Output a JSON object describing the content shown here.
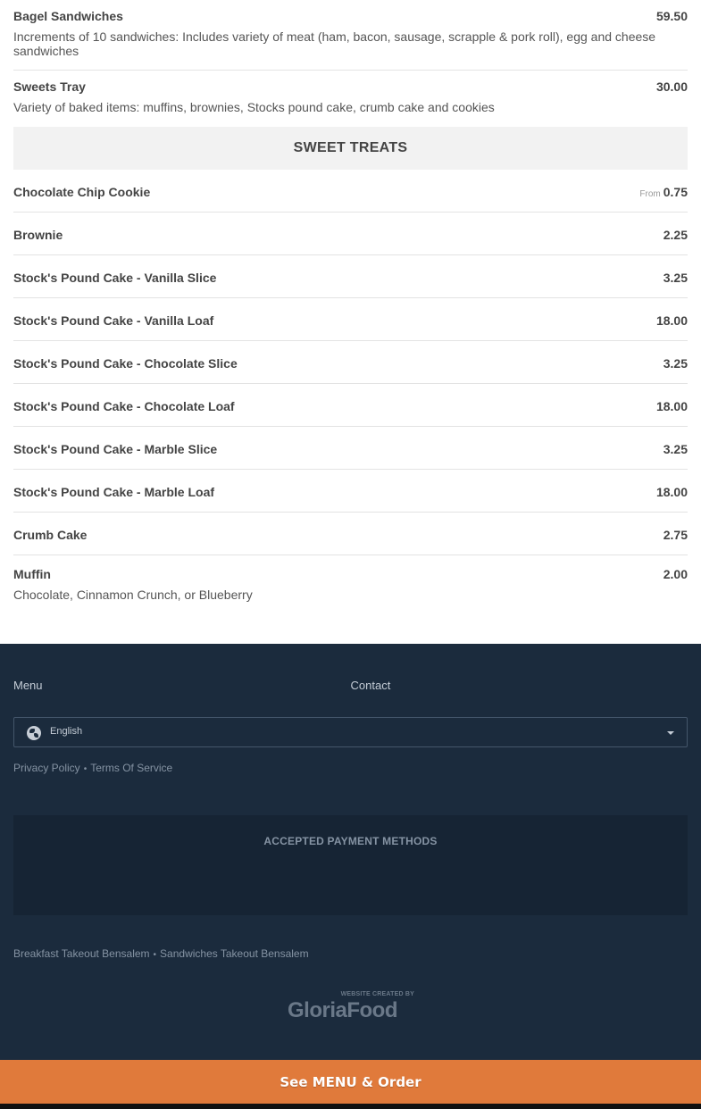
{
  "menu": {
    "items_top": [
      {
        "name": "Bagel Sandwiches",
        "price": "59.50",
        "desc": "Increments of 10 sandwiches: Includes variety of meat (ham, bacon, sausage, scrapple & pork roll), egg and cheese sandwiches"
      },
      {
        "name": "Sweets Tray",
        "price": "30.00",
        "desc": "Variety of baked items: muffins, brownies, Stocks pound cake, crumb cake and cookies"
      }
    ],
    "section_title": "SWEET TREATS",
    "sweet_items": [
      {
        "name": "Chocolate Chip Cookie",
        "price": "0.75",
        "prefix": "From"
      },
      {
        "name": "Brownie",
        "price": "2.25"
      },
      {
        "name": "Stock's Pound Cake - Vanilla Slice",
        "price": "3.25"
      },
      {
        "name": "Stock's Pound Cake - Vanilla Loaf",
        "price": "18.00"
      },
      {
        "name": "Stock's Pound Cake - Chocolate Slice",
        "price": "3.25"
      },
      {
        "name": "Stock's Pound Cake - Chocolate Loaf",
        "price": "18.00"
      },
      {
        "name": "Stock's Pound Cake - Marble Slice",
        "price": "3.25"
      },
      {
        "name": "Stock's Pound Cake - Marble Loaf",
        "price": "18.00"
      },
      {
        "name": "Crumb Cake",
        "price": "2.75"
      },
      {
        "name": "Muffin",
        "price": "2.00",
        "desc": "Chocolate, Cinnamon Crunch, or Blueberry"
      }
    ]
  },
  "footer": {
    "links": {
      "menu": "Menu",
      "contact": "Contact"
    },
    "language": {
      "selected": "English",
      "icon": "globe-icon"
    },
    "legal": {
      "privacy": "Privacy Policy",
      "terms": "Terms Of Service",
      "separator": "•"
    },
    "payments_title": "ACCEPTED PAYMENT METHODS",
    "seo": {
      "link1": "Breakfast Takeout Bensalem",
      "link2": "Sandwiches Takeout Bensalem",
      "separator": "•"
    },
    "brand": {
      "tagline": "WEBSITE CREATED BY",
      "name": "GloriaFood"
    }
  },
  "cta": {
    "label": "See MENU & Order",
    "color": "#e07a3b"
  }
}
